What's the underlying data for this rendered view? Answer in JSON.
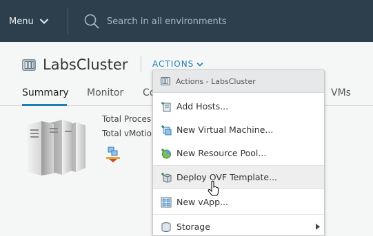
{
  "header": {
    "menu_label": "Menu",
    "search_placeholder": "Search in all environments"
  },
  "object": {
    "title": "LabsCluster",
    "actions_label": "ACTIONS"
  },
  "tabs": [
    {
      "label": "Summary",
      "active": true
    },
    {
      "label": "Monitor"
    },
    {
      "label": "Co"
    },
    {
      "label": "VMs"
    }
  ],
  "summary": {
    "row1": "Total Proces",
    "row2": "Total vMotio"
  },
  "dropdown": {
    "header": "Actions - LabsCluster",
    "items": [
      {
        "label": "Add Hosts...",
        "icon": "add-hosts-icon"
      },
      {
        "label": "New Virtual Machine...",
        "icon": "new-vm-icon"
      },
      {
        "label": "New Resource Pool...",
        "icon": "resource-pool-icon"
      },
      {
        "label": "Deploy OVF Template...",
        "icon": "deploy-ovf-icon",
        "hovered": true
      },
      {
        "label": "New vApp...",
        "icon": "vapp-icon"
      },
      {
        "label": "Storage",
        "icon": "storage-icon",
        "has_submenu": true
      }
    ]
  },
  "colors": {
    "header_bg": "#2d3f4d",
    "accent": "#1f7db6",
    "page_bg": "#f5f6f6"
  }
}
